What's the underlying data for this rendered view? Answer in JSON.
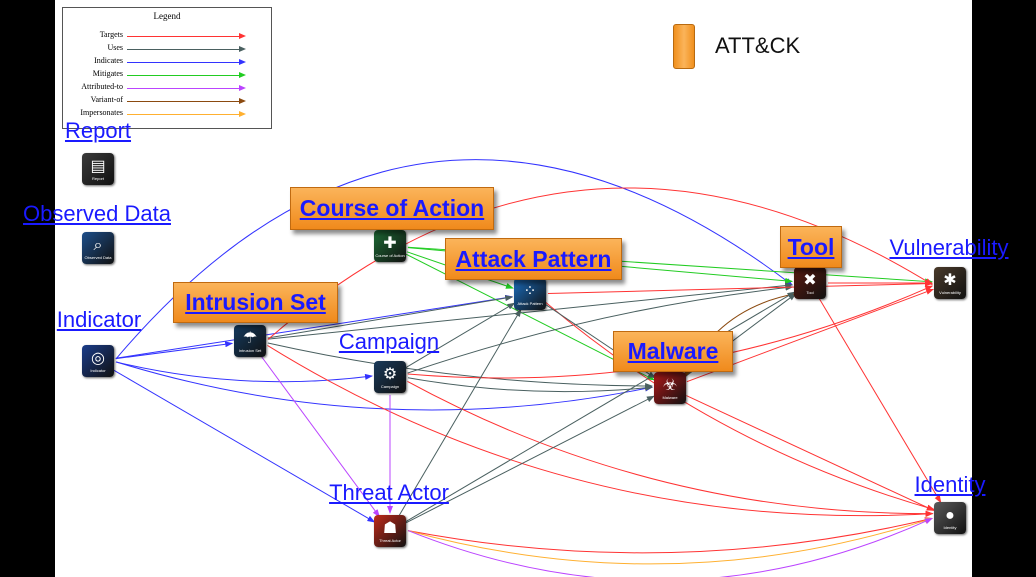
{
  "legend": {
    "title": "Legend",
    "items": [
      {
        "label": "Targets",
        "color": "#ff3333"
      },
      {
        "label": "Uses",
        "color": "#4a6060"
      },
      {
        "label": "Indicates",
        "color": "#3333ff"
      },
      {
        "label": "Mitigates",
        "color": "#22cc22"
      },
      {
        "label": "Attributed-to",
        "color": "#bb44ff"
      },
      {
        "label": "Variant-of",
        "color": "#8b4a10"
      },
      {
        "label": "Impersonates",
        "color": "#ffb030"
      }
    ]
  },
  "attck_legend": {
    "label": "ATT&CK",
    "color": "#f5a030"
  },
  "nodes": {
    "report": {
      "label": "Report",
      "caption": "Report",
      "icon": "report-icon",
      "color": "#3a3a3a",
      "attck": false
    },
    "observed_data": {
      "label": "Observed Data",
      "caption": "Observed Data",
      "icon": "magnifier-icon",
      "color": "#1d4e8a",
      "attck": false
    },
    "indicator": {
      "label": "Indicator",
      "caption": "Indicator",
      "icon": "fingerprint-icon",
      "color": "#1a3c8a",
      "attck": false
    },
    "course_of_action": {
      "label": "Course of Action",
      "caption": "Course of Action",
      "icon": "first-aid-kit-icon",
      "color": "#1d6b35",
      "attck": true
    },
    "attack_pattern": {
      "label": "Attack Pattern",
      "caption": "Attack Pattern",
      "icon": "attack-pattern-icon",
      "color": "#1a6ec0",
      "attck": true
    },
    "intrusion_set": {
      "label": "Intrusion Set",
      "caption": "Intrusion Set",
      "icon": "umbrella-icon",
      "color": "#143a5e",
      "attck": true
    },
    "campaign": {
      "label": "Campaign",
      "caption": "Campaign",
      "icon": "cannon-icon",
      "color": "#1a3a5a",
      "attck": false
    },
    "malware": {
      "label": "Malware",
      "caption": "Malware",
      "icon": "biohazard-icon",
      "color": "#b01818",
      "attck": true
    },
    "tool": {
      "label": "Tool",
      "caption": "Tool",
      "icon": "tools-icon",
      "color": "#5a1a10",
      "attck": true
    },
    "vulnerability": {
      "label": "Vulnerability",
      "caption": "Vulnerability",
      "icon": "bug-icon",
      "color": "#4a3a2a",
      "attck": false
    },
    "threat_actor": {
      "label": "Threat Actor",
      "caption": "Threat Actor",
      "icon": "spy-icon",
      "color": "#c02a1a",
      "attck": false
    },
    "identity": {
      "label": "Identity",
      "caption": "Identity",
      "icon": "person-icon",
      "color": "#5a5a5a",
      "attck": false
    }
  },
  "edges": [
    {
      "from": "indicator",
      "to": "attack_pattern",
      "type": "Indicates"
    },
    {
      "from": "indicator",
      "to": "intrusion_set",
      "type": "Indicates"
    },
    {
      "from": "indicator",
      "to": "campaign",
      "type": "Indicates"
    },
    {
      "from": "indicator",
      "to": "malware",
      "type": "Indicates"
    },
    {
      "from": "indicator",
      "to": "threat_actor",
      "type": "Indicates"
    },
    {
      "from": "indicator",
      "to": "tool",
      "type": "Indicates"
    },
    {
      "from": "course_of_action",
      "to": "attack_pattern",
      "type": "Mitigates"
    },
    {
      "from": "course_of_action",
      "to": "tool",
      "type": "Mitigates"
    },
    {
      "from": "course_of_action",
      "to": "vulnerability",
      "type": "Mitigates"
    },
    {
      "from": "course_of_action",
      "to": "malware",
      "type": "Mitigates"
    },
    {
      "from": "intrusion_set",
      "to": "attack_pattern",
      "type": "Uses"
    },
    {
      "from": "intrusion_set",
      "to": "malware",
      "type": "Uses"
    },
    {
      "from": "intrusion_set",
      "to": "tool",
      "type": "Uses"
    },
    {
      "from": "intrusion_set",
      "to": "vulnerability",
      "type": "Targets"
    },
    {
      "from": "intrusion_set",
      "to": "identity",
      "type": "Targets"
    },
    {
      "from": "intrusion_set",
      "to": "threat_actor",
      "type": "Attributed-to"
    },
    {
      "from": "campaign",
      "to": "attack_pattern",
      "type": "Uses"
    },
    {
      "from": "campaign",
      "to": "malware",
      "type": "Uses"
    },
    {
      "from": "campaign",
      "to": "tool",
      "type": "Uses"
    },
    {
      "from": "campaign",
      "to": "vulnerability",
      "type": "Targets"
    },
    {
      "from": "campaign",
      "to": "identity",
      "type": "Targets"
    },
    {
      "from": "campaign",
      "to": "threat_actor",
      "type": "Attributed-to"
    },
    {
      "from": "attack_pattern",
      "to": "vulnerability",
      "type": "Targets"
    },
    {
      "from": "attack_pattern",
      "to": "identity",
      "type": "Targets"
    },
    {
      "from": "attack_pattern",
      "to": "malware",
      "type": "Uses"
    },
    {
      "from": "malware",
      "to": "tool",
      "type": "Uses"
    },
    {
      "from": "malware",
      "to": "vulnerability",
      "type": "Targets"
    },
    {
      "from": "malware",
      "to": "identity",
      "type": "Targets"
    },
    {
      "from": "tool",
      "to": "malware",
      "type": "Variant-of"
    },
    {
      "from": "tool",
      "to": "vulnerability",
      "type": "Targets"
    },
    {
      "from": "tool",
      "to": "identity",
      "type": "Targets"
    },
    {
      "from": "threat_actor",
      "to": "attack_pattern",
      "type": "Uses"
    },
    {
      "from": "threat_actor",
      "to": "malware",
      "type": "Uses"
    },
    {
      "from": "threat_actor",
      "to": "tool",
      "type": "Uses"
    },
    {
      "from": "threat_actor",
      "to": "identity",
      "type": "Targets"
    },
    {
      "from": "threat_actor",
      "to": "identity",
      "type": "Impersonates"
    },
    {
      "from": "threat_actor",
      "to": "identity",
      "type": "Attributed-to"
    }
  ]
}
